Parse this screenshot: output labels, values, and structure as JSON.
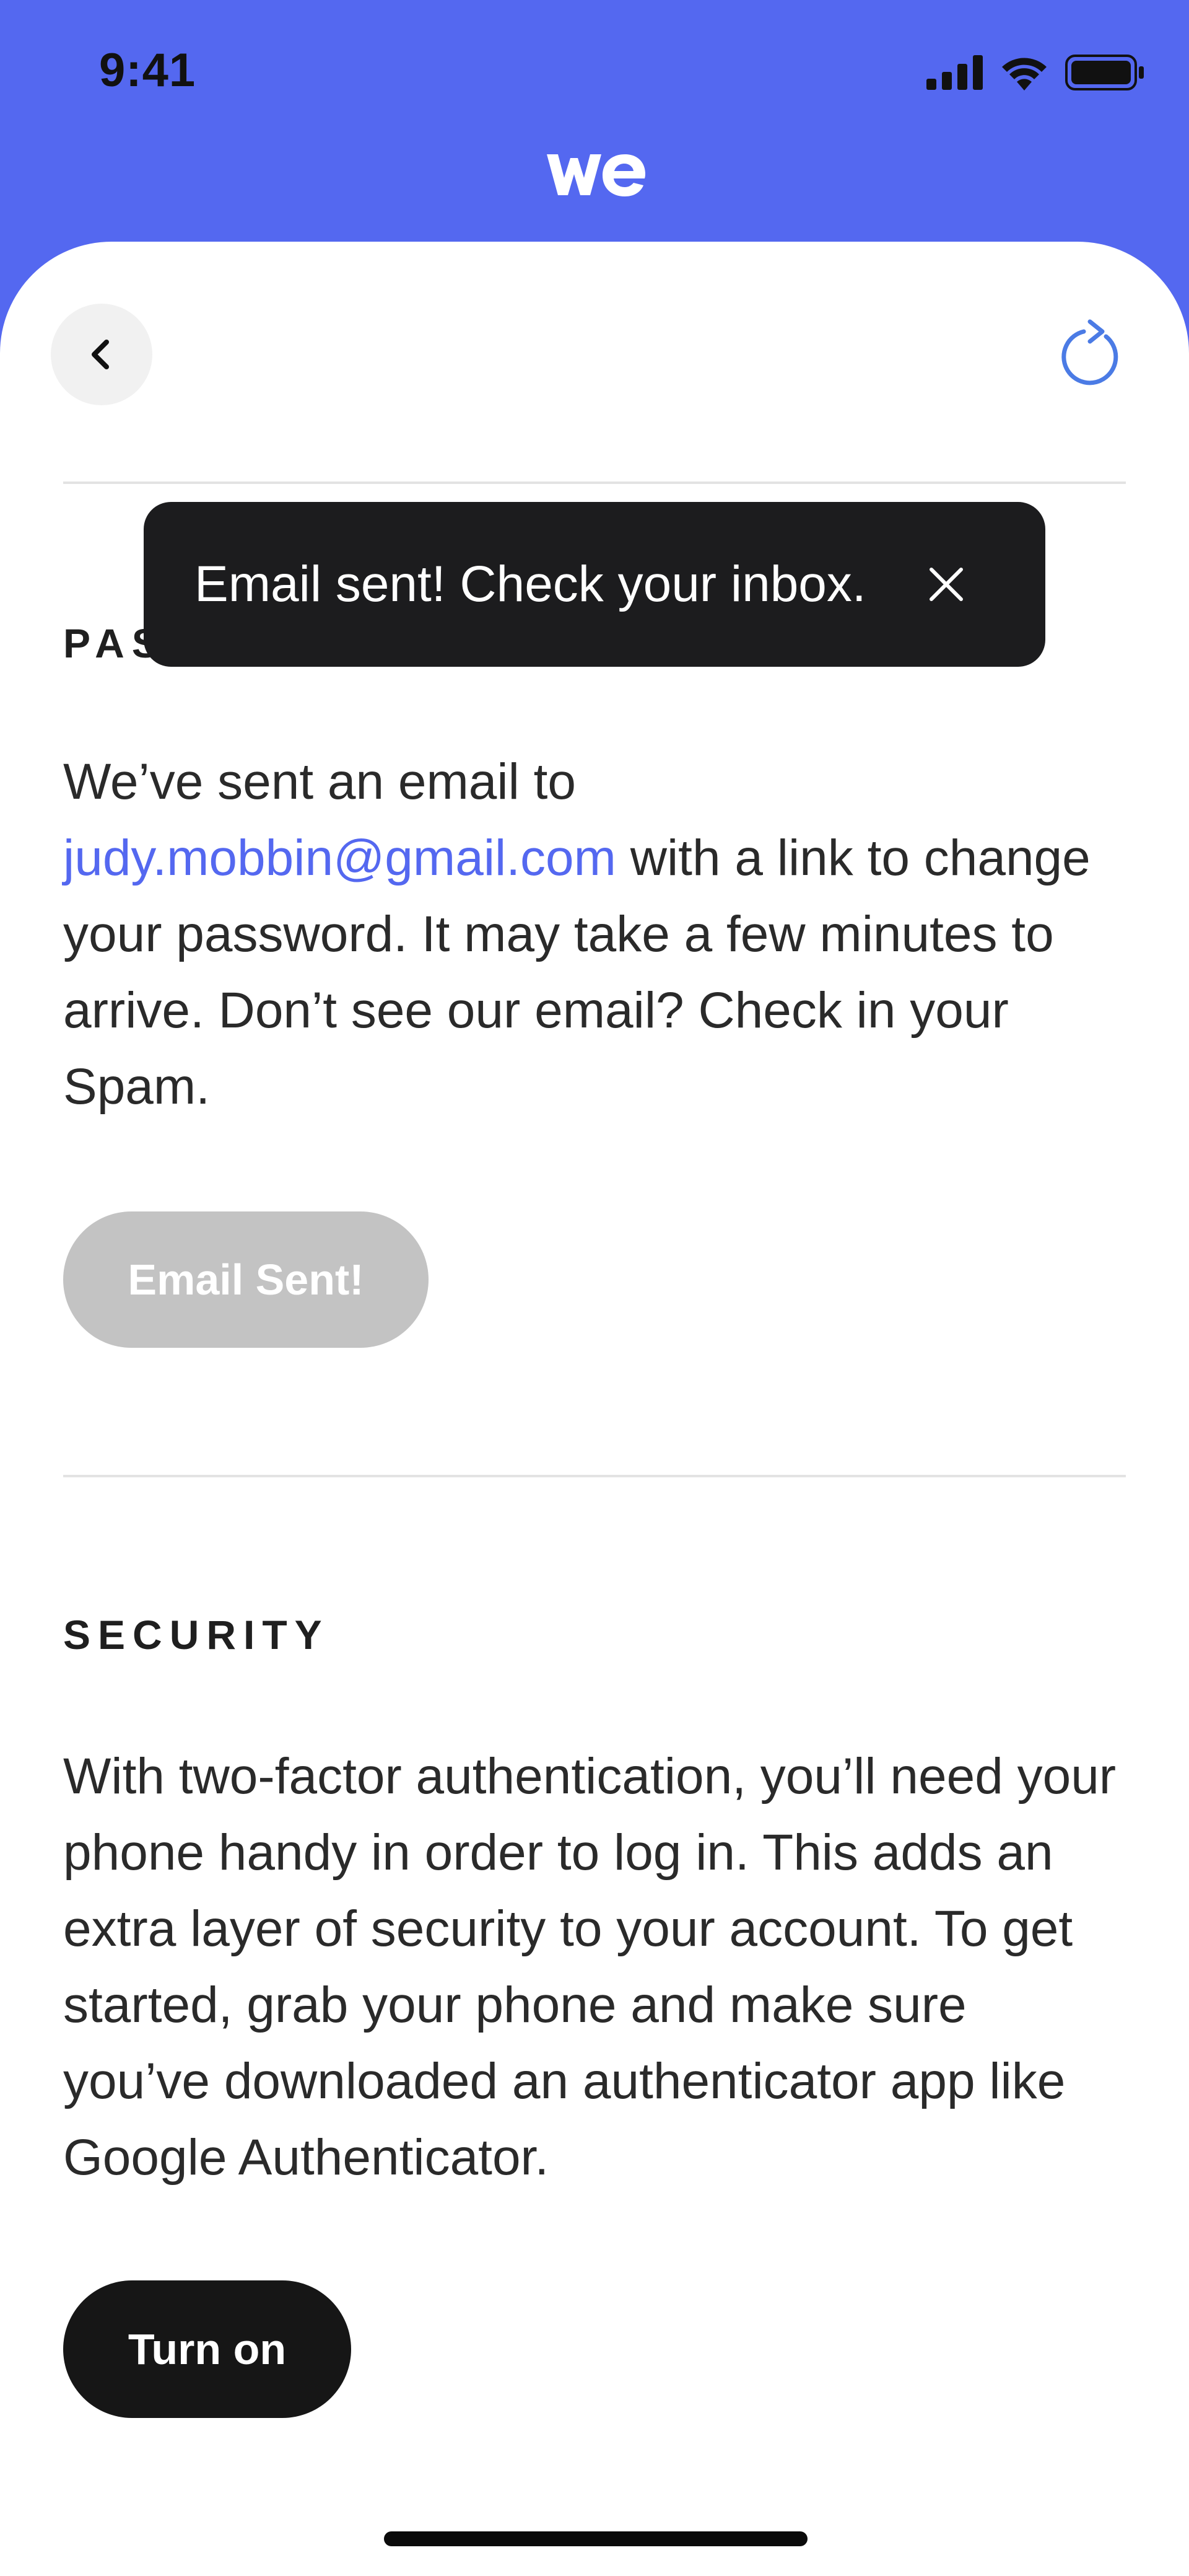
{
  "status_bar": {
    "time": "9:41",
    "icons": [
      "cellular-signal-icon",
      "wifi-icon",
      "battery-icon"
    ]
  },
  "brand": {
    "logo_icon": "wetransfer-we-logo-icon",
    "accent_color": "#5468F0"
  },
  "nav": {
    "back_icon": "chevron-left-icon",
    "refresh_icon": "refresh-icon"
  },
  "password_section": {
    "title": "PASSWORD",
    "message_prefix": "We’ve sent an email to",
    "email": "judy.mobbin@gmail.com",
    "message_suffix": "with a link to change your password. It may take a few minutes to arrive. Don’t see our email? Check in your Spam.",
    "button_label": "Email Sent!"
  },
  "security_section": {
    "title": "SECURITY",
    "description": "With two-factor authentication, you’ll need your phone handy in order to log in. This adds an extra layer of security to your account. To get started, grab your phone and make sure you’ve downloaded an authenticator app like Google Authenticator.",
    "button_label": "Turn on"
  },
  "toast": {
    "message": "Email sent! Check your inbox.",
    "close_icon": "close-icon"
  }
}
